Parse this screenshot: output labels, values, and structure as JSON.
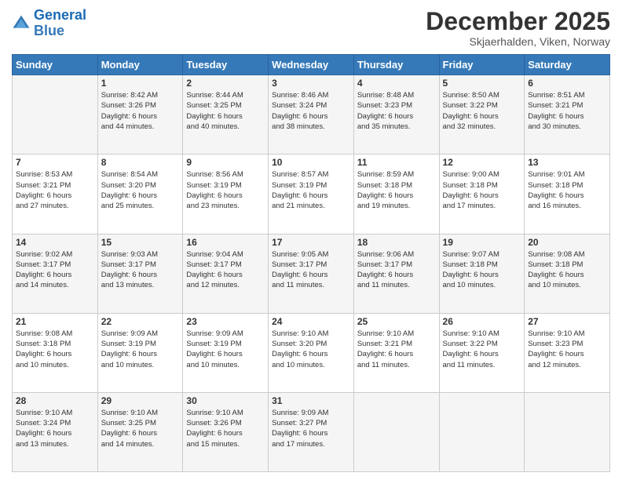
{
  "header": {
    "logo_line1": "General",
    "logo_line2": "Blue",
    "month": "December 2025",
    "location": "Skjaerhalden, Viken, Norway"
  },
  "days_of_week": [
    "Sunday",
    "Monday",
    "Tuesday",
    "Wednesday",
    "Thursday",
    "Friday",
    "Saturday"
  ],
  "weeks": [
    [
      {
        "day": "",
        "info": ""
      },
      {
        "day": "1",
        "info": "Sunrise: 8:42 AM\nSunset: 3:26 PM\nDaylight: 6 hours\nand 44 minutes."
      },
      {
        "day": "2",
        "info": "Sunrise: 8:44 AM\nSunset: 3:25 PM\nDaylight: 6 hours\nand 40 minutes."
      },
      {
        "day": "3",
        "info": "Sunrise: 8:46 AM\nSunset: 3:24 PM\nDaylight: 6 hours\nand 38 minutes."
      },
      {
        "day": "4",
        "info": "Sunrise: 8:48 AM\nSunset: 3:23 PM\nDaylight: 6 hours\nand 35 minutes."
      },
      {
        "day": "5",
        "info": "Sunrise: 8:50 AM\nSunset: 3:22 PM\nDaylight: 6 hours\nand 32 minutes."
      },
      {
        "day": "6",
        "info": "Sunrise: 8:51 AM\nSunset: 3:21 PM\nDaylight: 6 hours\nand 30 minutes."
      }
    ],
    [
      {
        "day": "7",
        "info": "Sunrise: 8:53 AM\nSunset: 3:21 PM\nDaylight: 6 hours\nand 27 minutes."
      },
      {
        "day": "8",
        "info": "Sunrise: 8:54 AM\nSunset: 3:20 PM\nDaylight: 6 hours\nand 25 minutes."
      },
      {
        "day": "9",
        "info": "Sunrise: 8:56 AM\nSunset: 3:19 PM\nDaylight: 6 hours\nand 23 minutes."
      },
      {
        "day": "10",
        "info": "Sunrise: 8:57 AM\nSunset: 3:19 PM\nDaylight: 6 hours\nand 21 minutes."
      },
      {
        "day": "11",
        "info": "Sunrise: 8:59 AM\nSunset: 3:18 PM\nDaylight: 6 hours\nand 19 minutes."
      },
      {
        "day": "12",
        "info": "Sunrise: 9:00 AM\nSunset: 3:18 PM\nDaylight: 6 hours\nand 17 minutes."
      },
      {
        "day": "13",
        "info": "Sunrise: 9:01 AM\nSunset: 3:18 PM\nDaylight: 6 hours\nand 16 minutes."
      }
    ],
    [
      {
        "day": "14",
        "info": "Sunrise: 9:02 AM\nSunset: 3:17 PM\nDaylight: 6 hours\nand 14 minutes."
      },
      {
        "day": "15",
        "info": "Sunrise: 9:03 AM\nSunset: 3:17 PM\nDaylight: 6 hours\nand 13 minutes."
      },
      {
        "day": "16",
        "info": "Sunrise: 9:04 AM\nSunset: 3:17 PM\nDaylight: 6 hours\nand 12 minutes."
      },
      {
        "day": "17",
        "info": "Sunrise: 9:05 AM\nSunset: 3:17 PM\nDaylight: 6 hours\nand 11 minutes."
      },
      {
        "day": "18",
        "info": "Sunrise: 9:06 AM\nSunset: 3:17 PM\nDaylight: 6 hours\nand 11 minutes."
      },
      {
        "day": "19",
        "info": "Sunrise: 9:07 AM\nSunset: 3:18 PM\nDaylight: 6 hours\nand 10 minutes."
      },
      {
        "day": "20",
        "info": "Sunrise: 9:08 AM\nSunset: 3:18 PM\nDaylight: 6 hours\nand 10 minutes."
      }
    ],
    [
      {
        "day": "21",
        "info": "Sunrise: 9:08 AM\nSunset: 3:18 PM\nDaylight: 6 hours\nand 10 minutes."
      },
      {
        "day": "22",
        "info": "Sunrise: 9:09 AM\nSunset: 3:19 PM\nDaylight: 6 hours\nand 10 minutes."
      },
      {
        "day": "23",
        "info": "Sunrise: 9:09 AM\nSunset: 3:19 PM\nDaylight: 6 hours\nand 10 minutes."
      },
      {
        "day": "24",
        "info": "Sunrise: 9:10 AM\nSunset: 3:20 PM\nDaylight: 6 hours\nand 10 minutes."
      },
      {
        "day": "25",
        "info": "Sunrise: 9:10 AM\nSunset: 3:21 PM\nDaylight: 6 hours\nand 11 minutes."
      },
      {
        "day": "26",
        "info": "Sunrise: 9:10 AM\nSunset: 3:22 PM\nDaylight: 6 hours\nand 11 minutes."
      },
      {
        "day": "27",
        "info": "Sunrise: 9:10 AM\nSunset: 3:23 PM\nDaylight: 6 hours\nand 12 minutes."
      }
    ],
    [
      {
        "day": "28",
        "info": "Sunrise: 9:10 AM\nSunset: 3:24 PM\nDaylight: 6 hours\nand 13 minutes."
      },
      {
        "day": "29",
        "info": "Sunrise: 9:10 AM\nSunset: 3:25 PM\nDaylight: 6 hours\nand 14 minutes."
      },
      {
        "day": "30",
        "info": "Sunrise: 9:10 AM\nSunset: 3:26 PM\nDaylight: 6 hours\nand 15 minutes."
      },
      {
        "day": "31",
        "info": "Sunrise: 9:09 AM\nSunset: 3:27 PM\nDaylight: 6 hours\nand 17 minutes."
      },
      {
        "day": "",
        "info": ""
      },
      {
        "day": "",
        "info": ""
      },
      {
        "day": "",
        "info": ""
      }
    ]
  ]
}
